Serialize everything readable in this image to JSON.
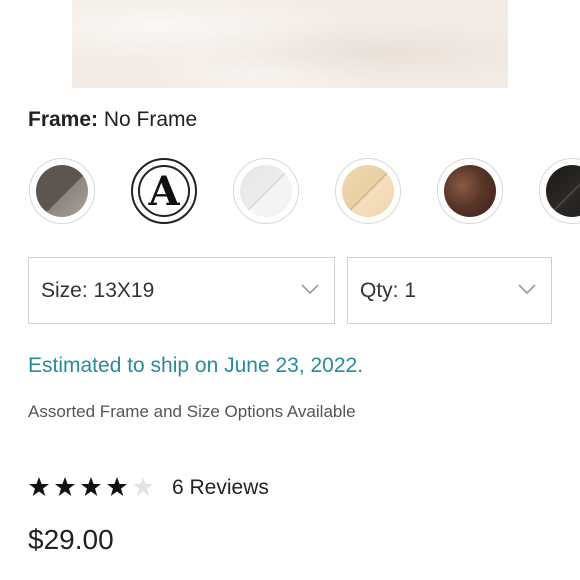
{
  "product": {
    "frame_key": "Frame:",
    "frame_value": "No Frame",
    "frame_options": [
      {
        "name": "gray-wood",
        "colors": [
          "#5b5652",
          "#8d8782"
        ]
      },
      {
        "name": "no-frame",
        "glyph": "A",
        "selected": true
      },
      {
        "name": "white",
        "colors": [
          "#e6e6e6",
          "#f6f6f6"
        ]
      },
      {
        "name": "natural-wood",
        "colors": [
          "#e9cfa4",
          "#f5dfbd"
        ]
      },
      {
        "name": "dark-walnut",
        "colors": [
          "#4a2c22",
          "#8a5a44"
        ]
      },
      {
        "name": "black",
        "colors": [
          "#1c1a18",
          "#4a4440"
        ]
      }
    ],
    "size_select": {
      "label": "Size: 13X19",
      "icon": "chevron-down-icon"
    },
    "qty_select": {
      "label": "Qty: 1",
      "icon": "chevron-down-icon"
    },
    "ship_text": "Estimated to ship on June 23, 2022.",
    "assorted_text": "Assorted Frame and Size Options Available",
    "rating": 4,
    "rating_max": 5,
    "reviews_text": "6 Reviews",
    "price": "$29.00"
  },
  "colors": {
    "accent": "#2a8a99",
    "star_filled": "#111111",
    "star_empty": "#e3e3e3"
  }
}
